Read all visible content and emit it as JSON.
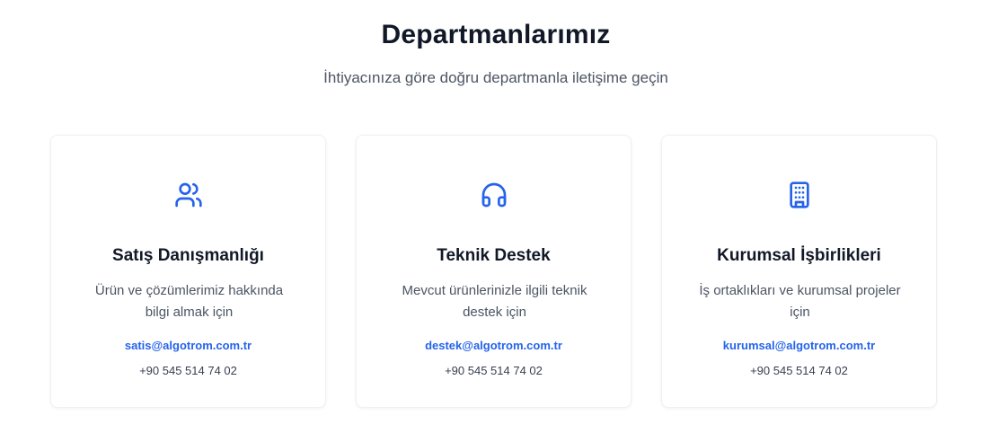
{
  "section": {
    "title": "Departmanlarımız",
    "subtitle": "İhtiyacınıza göre doğru departmanla iletişime geçin"
  },
  "colors": {
    "accent": "#2563eb",
    "title": "#111827",
    "body_text": "#4b5563"
  },
  "departments": [
    {
      "icon": "users-icon",
      "title": "Satış Danışmanlığı",
      "description": "Ürün ve çözümlerimiz hakkında bilgi almak için",
      "email": "satis@algotrom.com.tr",
      "phone": "+90 545 514 74 02"
    },
    {
      "icon": "headphones-icon",
      "title": "Teknik Destek",
      "description": "Mevcut ürünlerinizle ilgili teknik destek için",
      "email": "destek@algotrom.com.tr",
      "phone": "+90 545 514 74 02"
    },
    {
      "icon": "building-icon",
      "title": "Kurumsal İşbirlikleri",
      "description": "İş ortaklıkları ve kurumsal projeler için",
      "email": "kurumsal@algotrom.com.tr",
      "phone": "+90 545 514 74 02"
    }
  ]
}
